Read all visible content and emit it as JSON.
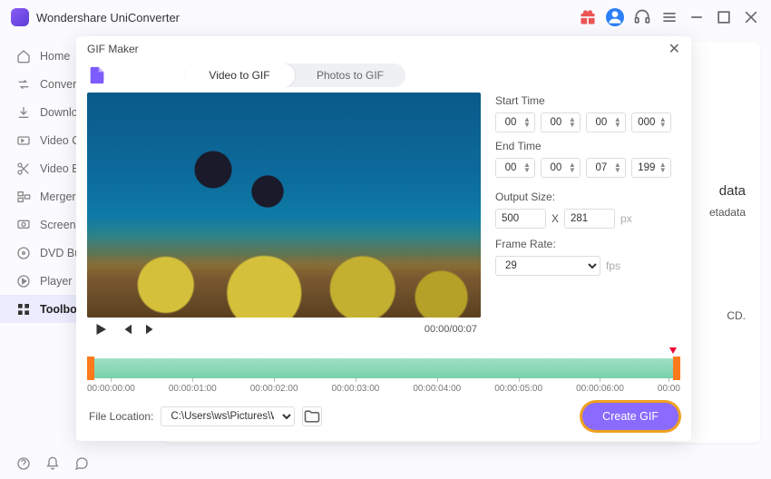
{
  "app": {
    "title": "Wondershare UniConverter"
  },
  "sidebar": {
    "items": [
      {
        "label": "Home"
      },
      {
        "label": "Converter"
      },
      {
        "label": "Downloader"
      },
      {
        "label": "Video Compressor"
      },
      {
        "label": "Video Editor"
      },
      {
        "label": "Merger"
      },
      {
        "label": "Screen Recorder"
      },
      {
        "label": "DVD Burner"
      },
      {
        "label": "Player"
      },
      {
        "label": "Toolbox"
      }
    ]
  },
  "bg": {
    "heading": "data",
    "line1": "etadata",
    "line2": "CD."
  },
  "modal": {
    "title": "GIF Maker",
    "tabs": {
      "video": "Video to GIF",
      "photos": "Photos to GIF"
    },
    "time_current": "00:00/00:07",
    "start_label": "Start Time",
    "end_label": "End Time",
    "start": {
      "hh": "00",
      "mm": "00",
      "ss": "00",
      "ms": "000"
    },
    "end": {
      "hh": "00",
      "mm": "00",
      "ss": "07",
      "ms": "199"
    },
    "output_label": "Output Size:",
    "output_w": "500",
    "output_h": "281",
    "output_sep": "X",
    "output_unit": "px",
    "frame_label": "Frame Rate:",
    "frame_value": "29",
    "frame_unit": "fps",
    "ticks": [
      "00:00:00:00",
      "00:00:01:00",
      "00:00:02:00",
      "00:00:03:00",
      "00:00:04:00",
      "00:00:05:00",
      "00:00:06:00",
      "00:00"
    ],
    "file_label": "File Location:",
    "file_path": "C:\\Users\\ws\\Pictures\\Wonders",
    "create_label": "Create GIF"
  }
}
